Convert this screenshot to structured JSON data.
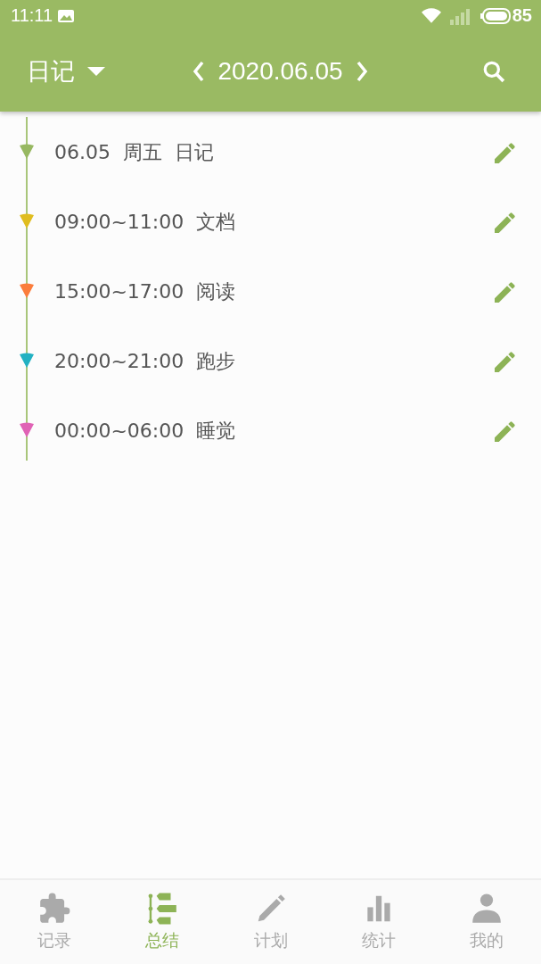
{
  "status_bar": {
    "time": "11:11",
    "battery": "85"
  },
  "header": {
    "title": "日记",
    "date": "2020.06.05"
  },
  "entries": [
    {
      "text": "06.05  周五  日记",
      "color": "#97b861"
    },
    {
      "text": "09:00~11:00  文档",
      "color": "#e0bd1f"
    },
    {
      "text": "15:00~17:00  阅读",
      "color": "#fb7d3c"
    },
    {
      "text": "20:00~21:00  跑步",
      "color": "#22b1c2"
    },
    {
      "text": "00:00~06:00  睡觉",
      "color": "#e063b5"
    }
  ],
  "tabs": [
    {
      "label": "记录",
      "kind": "puzzle",
      "selected": false
    },
    {
      "label": "总结",
      "kind": "timeline",
      "selected": true
    },
    {
      "label": "计划",
      "kind": "pencil",
      "selected": false
    },
    {
      "label": "统计",
      "kind": "bars",
      "selected": false
    },
    {
      "label": "我的",
      "kind": "person",
      "selected": false
    }
  ]
}
